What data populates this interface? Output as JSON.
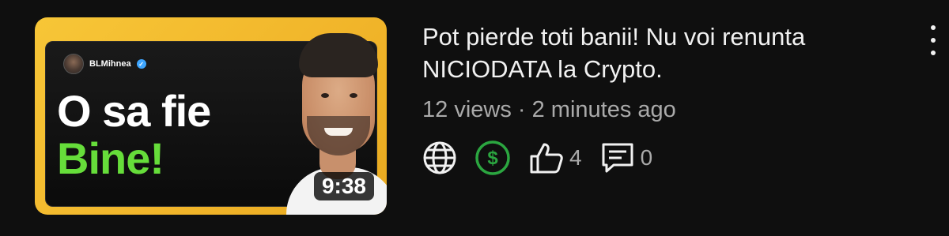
{
  "video": {
    "title": "Pot pierde toti banii! Nu voi renunta NICIODATA la Crypto.",
    "views": "12 views",
    "separator": "·",
    "age": "2 minutes ago",
    "duration": "9:38"
  },
  "thumbnail": {
    "channel_name": "BLMihnea",
    "verified_mark": "✓",
    "headline_line1": "O sa fie",
    "headline_line2": "Bine!",
    "accent_color": "#66dd3a",
    "background_color": "#f2b92c"
  },
  "actions": {
    "globe_icon": "globe-icon",
    "monetization_icon": "dollar-icon",
    "likes_icon": "thumbs-up-icon",
    "likes_count": "4",
    "comments_icon": "comment-icon",
    "comments_count": "0"
  },
  "more_menu_icon": "more-vertical-icon",
  "colors": {
    "background": "#0f0f0f",
    "monetization_green": "#2ba640"
  }
}
